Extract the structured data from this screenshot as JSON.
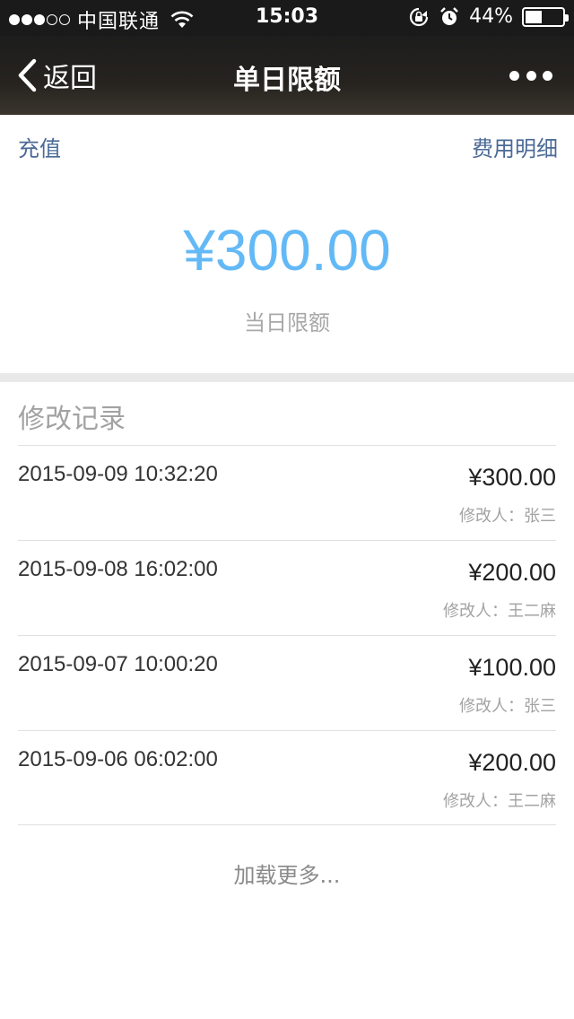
{
  "status_bar": {
    "carrier": "中国联通",
    "time": "15:03",
    "battery_percent_label": "44%",
    "battery_level": 0.44,
    "signal_bars_filled": 3,
    "signal_bars_total": 5
  },
  "nav": {
    "back_label": "返回",
    "title": "单日限额"
  },
  "links": {
    "recharge": "充值",
    "expense_details": "费用明细"
  },
  "limit": {
    "amount": "¥300.00",
    "label": "当日限额"
  },
  "records": {
    "title": "修改记录",
    "items": [
      {
        "datetime": "2015-09-09 10:32:20",
        "amount": "¥300.00",
        "editor": "修改人：张三"
      },
      {
        "datetime": "2015-09-08 16:02:00",
        "amount": "¥200.00",
        "editor": "修改人：王二麻"
      },
      {
        "datetime": "2015-09-07 10:00:20",
        "amount": "¥100.00",
        "editor": "修改人：张三"
      },
      {
        "datetime": "2015-09-06 06:02:00",
        "amount": "¥200.00",
        "editor": "修改人：王二麻"
      }
    ],
    "load_more": "加载更多..."
  },
  "colors": {
    "amount_blue": "#63b9f6",
    "link_blue": "#4b6a96",
    "nav_background": "#1d1d1d"
  }
}
